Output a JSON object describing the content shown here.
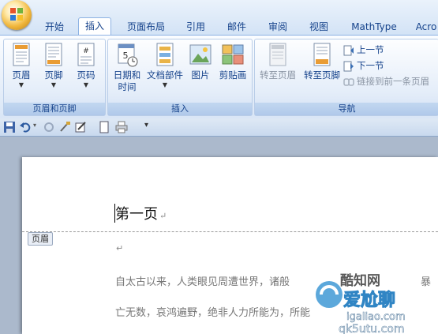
{
  "tabs": [
    "开始",
    "插入",
    "页面布局",
    "引用",
    "邮件",
    "审阅",
    "视图",
    "MathType",
    "Acro"
  ],
  "active_tab": "插入",
  "groups": {
    "header_footer": {
      "label": "页眉和页脚",
      "buttons": [
        "页眉",
        "页脚",
        "页码"
      ]
    },
    "insert": {
      "label": "插入",
      "date_time": [
        "日期和",
        "时间"
      ],
      "doc_parts": "文档部件",
      "picture": "图片",
      "clipart": "剪贴画"
    },
    "nav": {
      "label": "导航",
      "goto_header": "转至页眉",
      "goto_footer": "转至页脚",
      "prev_section": "上一节",
      "next_section": "下一节",
      "link_prev": "链接到前一条页眉"
    }
  },
  "document": {
    "heading": "第一页",
    "header_tag": "页眉",
    "para_mark": "↵",
    "line1": "自太古以来，人类眼见周遭世界，诸般",
    "line1_tail": "暴",
    "line2": "亡无数，哀鸿遍野，绝非人力所能为，所能"
  },
  "watermark": {
    "top": "酷知网",
    "mid": "爱尬聊",
    "url1": "igaliao.com",
    "url2": "qk5utu.com"
  },
  "colors": {
    "accent": "#15428b",
    "ribbon_border": "#8db2e3"
  }
}
